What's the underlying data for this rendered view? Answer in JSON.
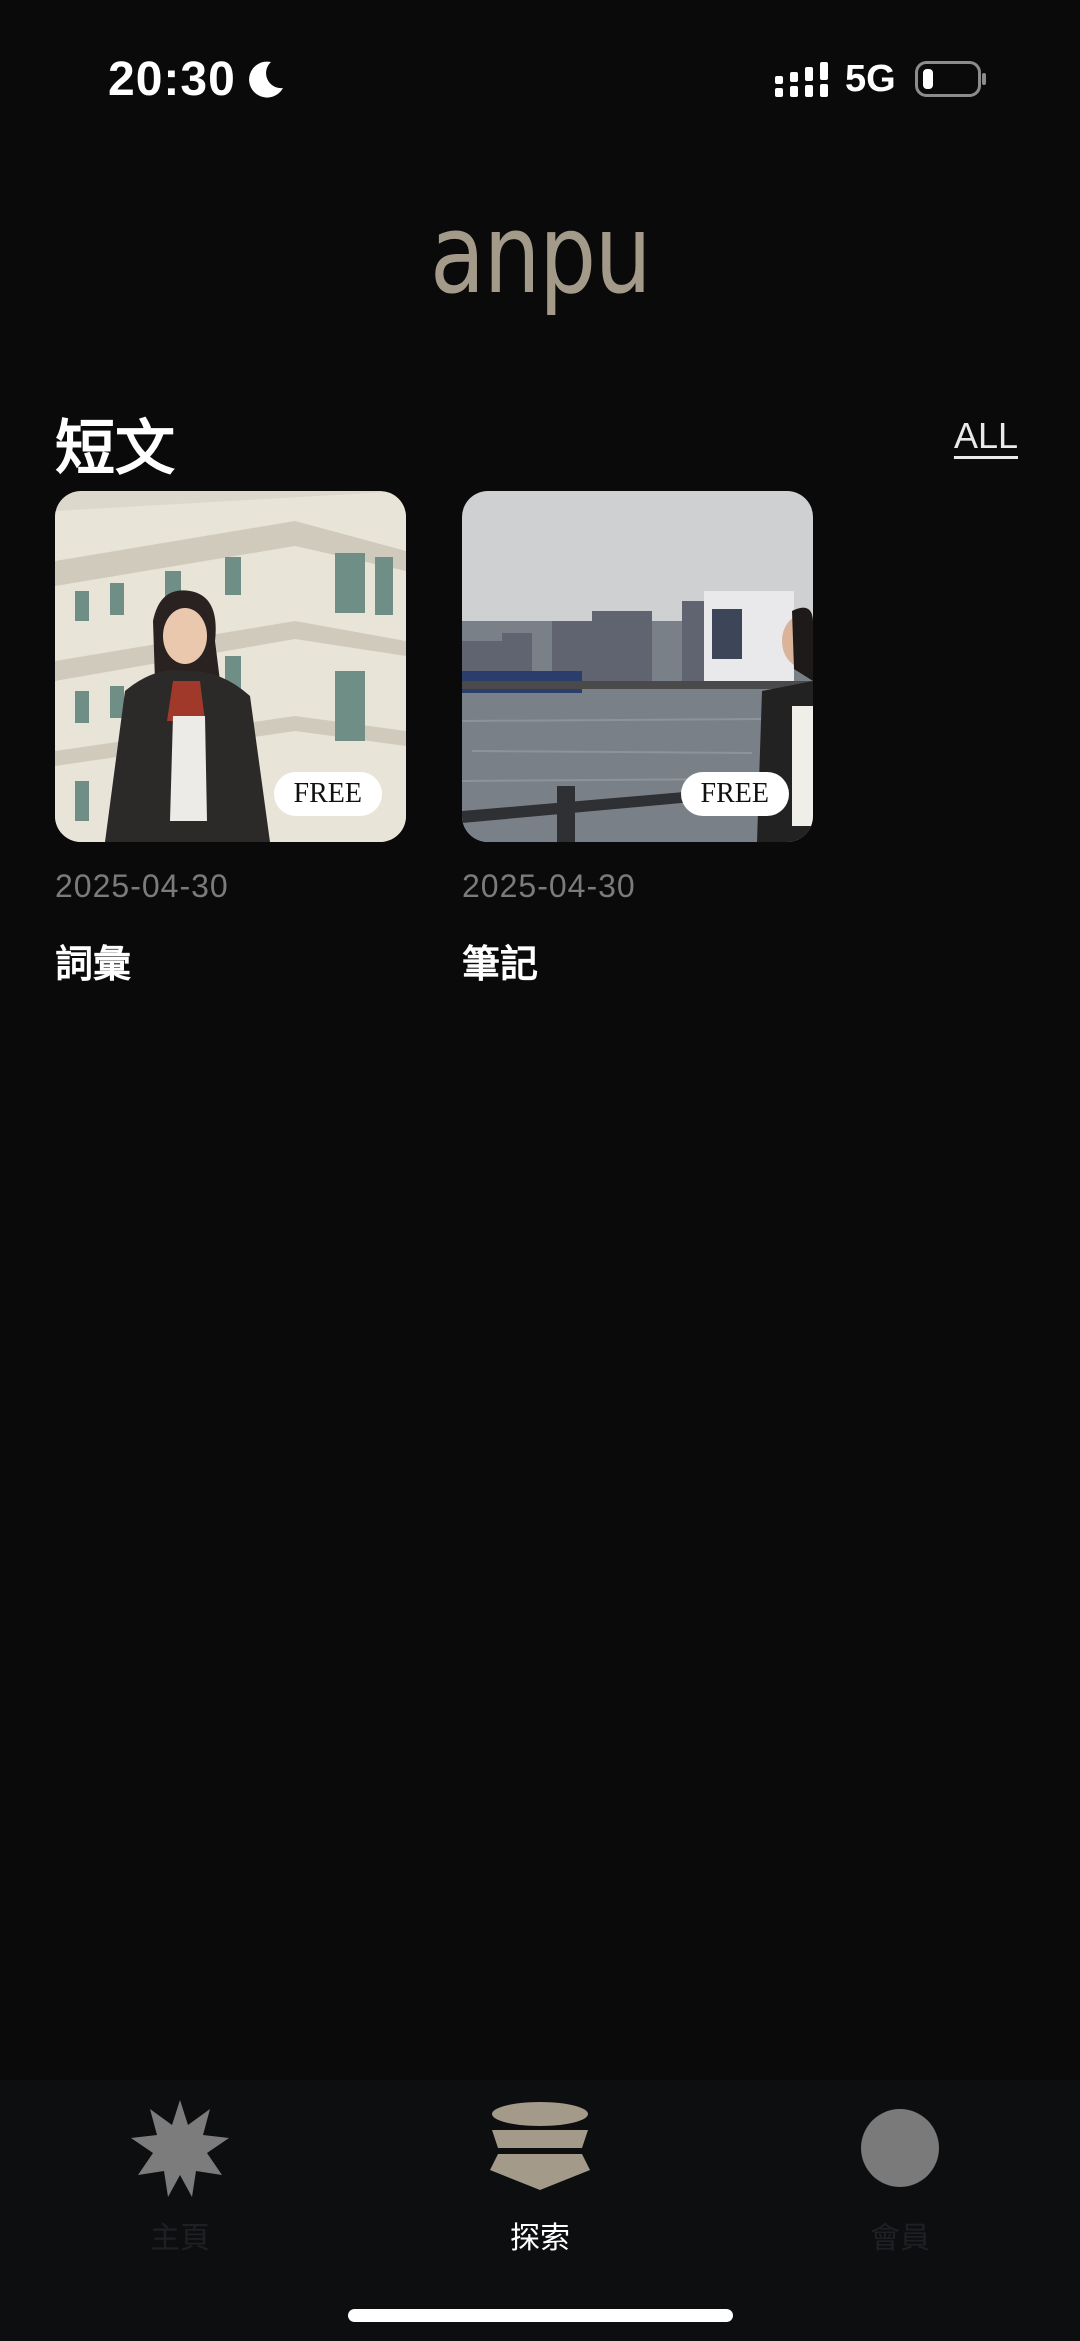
{
  "status_bar": {
    "time": "20:30",
    "network": "5G",
    "icons": [
      "moon-icon",
      "signal-icon",
      "battery-icon"
    ]
  },
  "logo": {
    "text": "anpu",
    "color": "#a39a8a"
  },
  "section": {
    "title": "短文",
    "all_label": "ALL"
  },
  "cards": [
    {
      "badge": "FREE",
      "date": "2025-04-30",
      "title": "詞彙",
      "image": "woman-in-front-of-building-photo"
    },
    {
      "badge": "FREE",
      "date": "2025-04-30",
      "title": "筆記",
      "image": "woman-at-harbor-photo"
    }
  ],
  "tabs": [
    {
      "label": "主頁",
      "icon": "starburst-icon",
      "active": false
    },
    {
      "label": "探索",
      "icon": "stack-layers-icon",
      "active": true
    },
    {
      "label": "會員",
      "icon": "circle-icon",
      "active": false
    }
  ],
  "colors": {
    "background": "#0a0a0a",
    "accent": "#a39a8a",
    "date_text": "#7b7b7b",
    "tab_bar": "#0d0e10"
  }
}
